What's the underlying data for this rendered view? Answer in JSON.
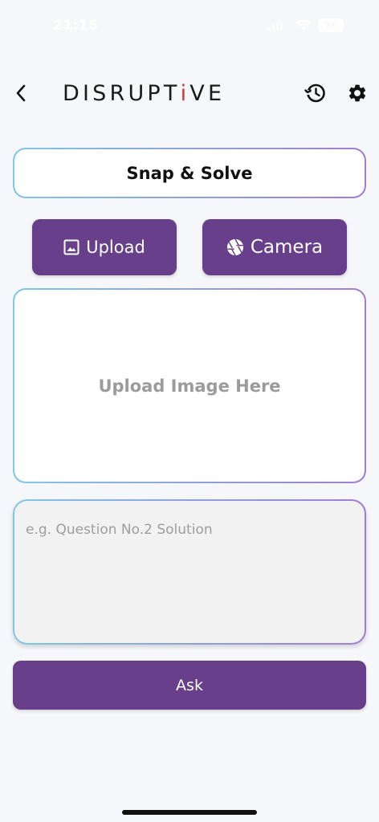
{
  "status_bar": {
    "time": "21:15",
    "battery": "76"
  },
  "header": {
    "logo_part1": "DISRUPT",
    "logo_i": "i",
    "logo_part2": "VE"
  },
  "title": "Snap & Solve",
  "upload_button": {
    "label": "Upload",
    "icon": "image-icon"
  },
  "camera_button": {
    "label": "Camera",
    "icon": "aperture-icon"
  },
  "upload_area": {
    "label": "Upload Image Here"
  },
  "question": {
    "placeholder": "e.g. Question No.2 Solution",
    "value": ""
  },
  "ask_button": {
    "label": "Ask"
  },
  "colors": {
    "primary": "#673f8a",
    "background": "#f6f7fa",
    "border_gradient_start": "#7fc7e6",
    "border_gradient_end": "#a07cd4",
    "logo_accent": "#d9322b"
  }
}
